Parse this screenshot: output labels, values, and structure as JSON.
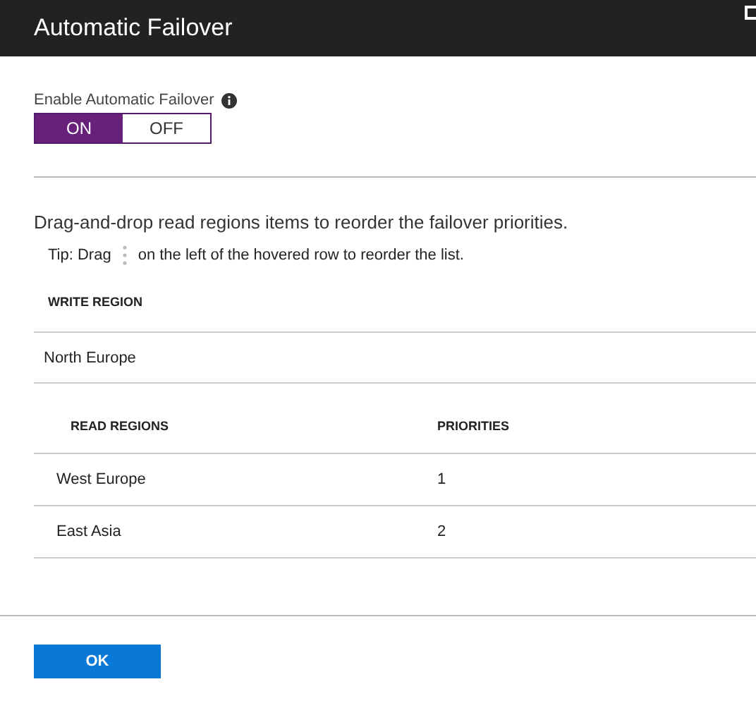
{
  "window": {
    "title": "Automatic Failover"
  },
  "toggle": {
    "label": "Enable Automatic Failover",
    "options": [
      {
        "label": "ON",
        "selected": true
      },
      {
        "label": "OFF",
        "selected": false
      }
    ]
  },
  "description": "Drag-and-drop read regions items to reorder the failover priorities.",
  "tip": {
    "before": "Tip: Drag",
    "after": "on the left of the hovered row to reorder the list."
  },
  "write_region": {
    "heading": "WRITE REGION",
    "value": "North Europe"
  },
  "read_regions": {
    "columns": [
      "READ REGIONS",
      "PRIORITIES"
    ],
    "rows": [
      [
        "West Europe",
        "1"
      ],
      [
        "East Asia",
        "2"
      ]
    ]
  },
  "buttons": [
    "OK"
  ]
}
